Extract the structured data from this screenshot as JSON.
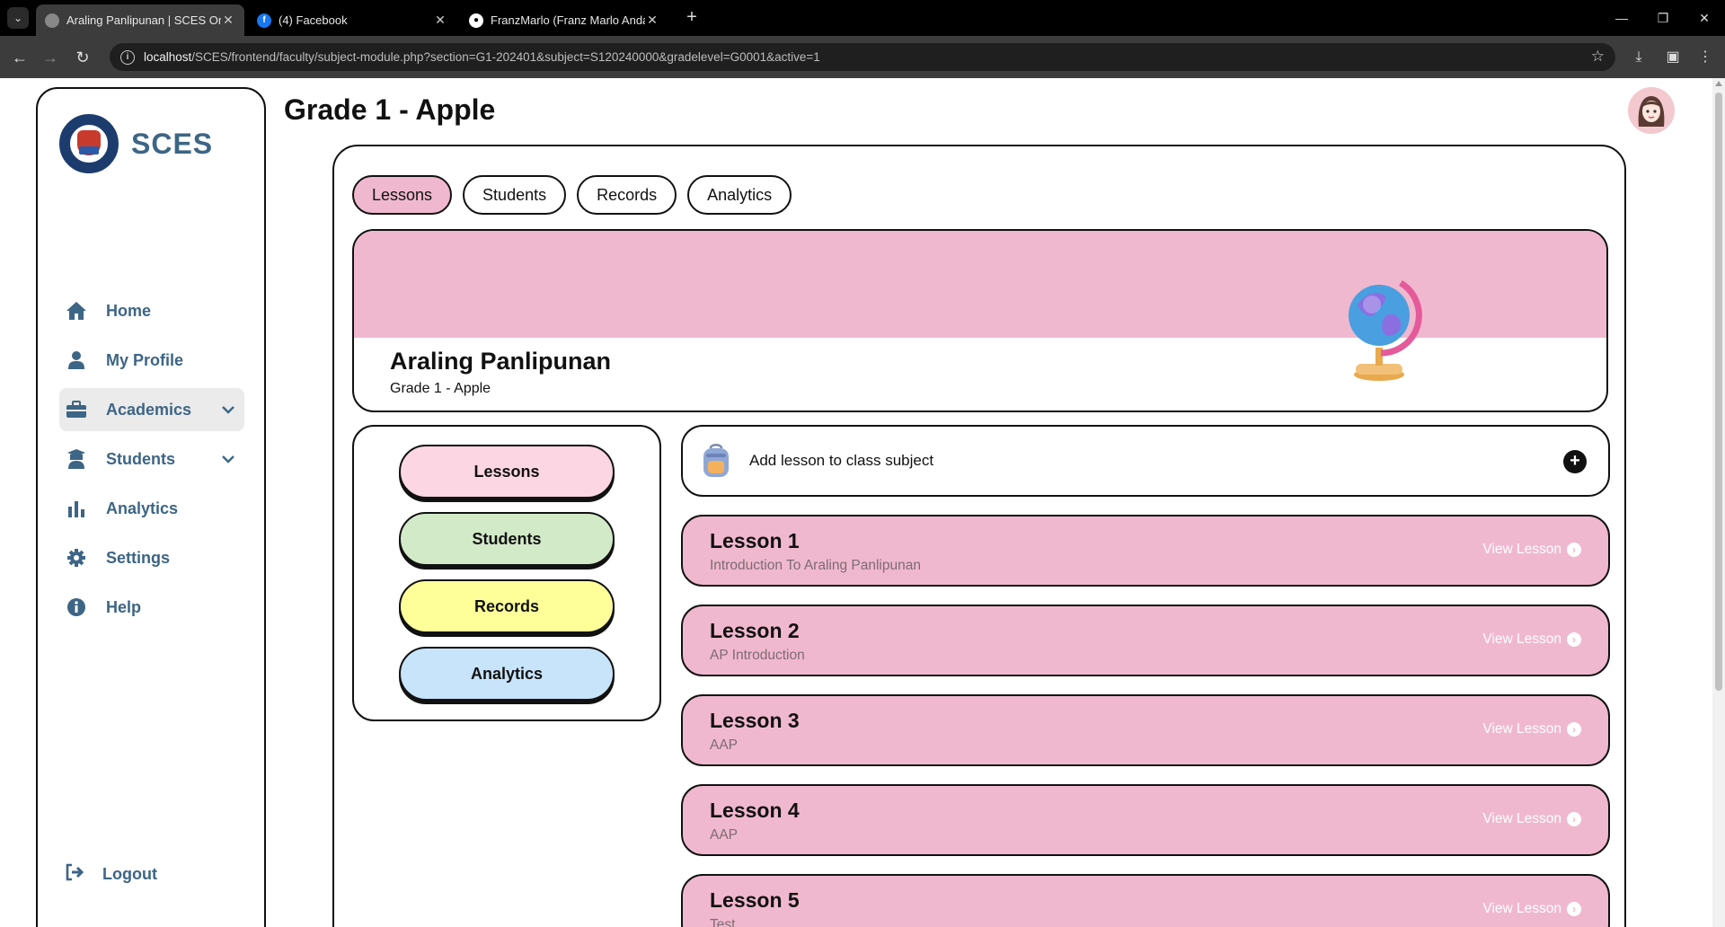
{
  "browser": {
    "tabs": [
      {
        "title": "Araling Panlipunan | SCES Online",
        "active": true
      },
      {
        "title": "(4) Facebook",
        "active": false
      },
      {
        "title": "FranzMarlo (Franz Marlo Andal)",
        "active": false
      }
    ],
    "url_host": "localhost",
    "url_path": "/SCES/frontend/faculty/subject-module.php?section=G1-202401&subject=S120240000&gradelevel=G0001&active=1"
  },
  "sidebar": {
    "brand": "SCES",
    "items": [
      {
        "label": "Home",
        "icon": "home-icon"
      },
      {
        "label": "My Profile",
        "icon": "user-icon"
      },
      {
        "label": "Academics",
        "icon": "briefcase-icon",
        "active": true,
        "has_submenu": true
      },
      {
        "label": "Students",
        "icon": "graduate-icon",
        "has_submenu": true
      },
      {
        "label": "Analytics",
        "icon": "bar-chart-icon"
      },
      {
        "label": "Settings",
        "icon": "gear-icon"
      },
      {
        "label": "Help",
        "icon": "info-icon"
      }
    ],
    "logout": "Logout"
  },
  "header": {
    "title": "Grade 1 - Apple"
  },
  "panel": {
    "tabs": [
      {
        "label": "Lessons",
        "active": true
      },
      {
        "label": "Students",
        "active": false
      },
      {
        "label": "Records",
        "active": false
      },
      {
        "label": "Analytics",
        "active": false
      }
    ],
    "banner": {
      "subject": "Araling Panlipunan",
      "section": "Grade 1 - Apple"
    },
    "side_buttons": [
      {
        "label": "Lessons",
        "color": "#fcd6e3"
      },
      {
        "label": "Students",
        "color": "#d3eac8"
      },
      {
        "label": "Records",
        "color": "#ffff99"
      },
      {
        "label": "Analytics",
        "color": "#c8e4fb"
      }
    ],
    "add_lesson": "Add lesson to class subject",
    "view_label": "View Lesson",
    "lessons": [
      {
        "title": "Lesson 1",
        "desc": "Introduction To Araling Panlipunan"
      },
      {
        "title": "Lesson 2",
        "desc": "AP Introduction"
      },
      {
        "title": "Lesson 3",
        "desc": "AAP"
      },
      {
        "title": "Lesson 4",
        "desc": "AAP"
      },
      {
        "title": "Lesson 5",
        "desc": "Test"
      }
    ]
  },
  "colors": {
    "accent_pink": "#f0b8ce",
    "nav_text": "#3d6585"
  }
}
